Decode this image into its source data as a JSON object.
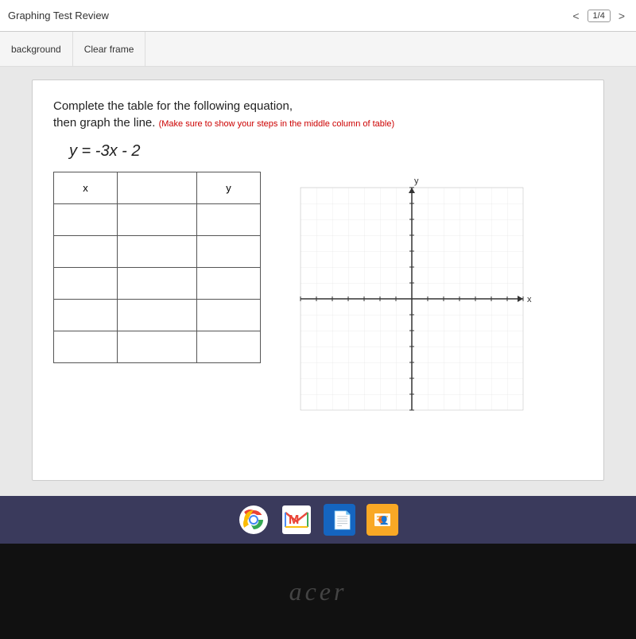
{
  "topbar": {
    "title": "Graphing Test Review",
    "prev_label": "<",
    "next_label": ">",
    "page_indicator": "1/4"
  },
  "toolbar": {
    "background_label": "background",
    "clear_frame_label": "Clear frame"
  },
  "slide": {
    "instruction_main": "Complete the table for the following equation,",
    "instruction_main2": "then graph the line.",
    "instruction_note": "(Make sure to show your steps in the middle column of table)",
    "equation": "y = -3x - 2",
    "table": {
      "col_x_header": "x",
      "col_mid_header": "",
      "col_y_header": "y",
      "rows": [
        {
          "x": "",
          "mid": "",
          "y": ""
        },
        {
          "x": "",
          "mid": "",
          "y": ""
        },
        {
          "x": "",
          "mid": "",
          "y": ""
        },
        {
          "x": "",
          "mid": "",
          "y": ""
        },
        {
          "x": "",
          "mid": "",
          "y": ""
        }
      ]
    }
  },
  "taskbar": {
    "icons": [
      {
        "name": "chrome",
        "color": "#4285f4"
      },
      {
        "name": "gmail",
        "color": "#ea4335"
      },
      {
        "name": "drive",
        "color": "#1565c0"
      },
      {
        "name": "slides",
        "color": "#f9a825"
      }
    ]
  },
  "acer": {
    "brand": "acer"
  },
  "graph": {
    "x_label": "x",
    "y_label": "y",
    "grid_size": 20,
    "grid_count": 14
  }
}
